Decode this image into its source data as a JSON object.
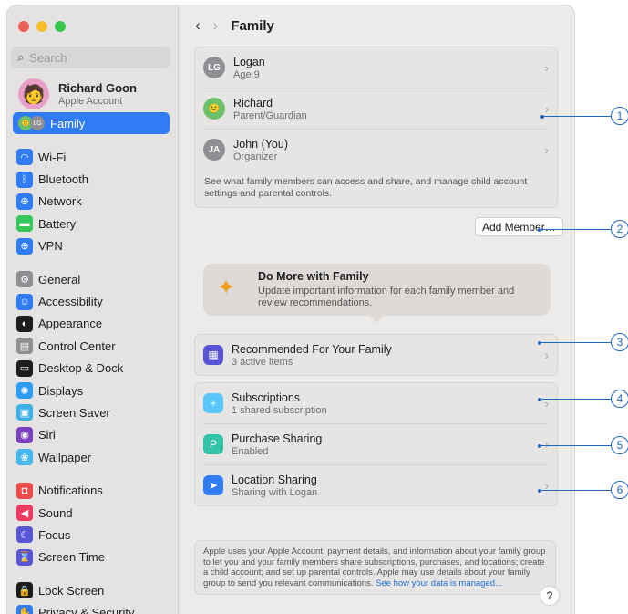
{
  "window": {
    "traffic_lights": {
      "close": "#ee5e58",
      "minimize": "#f5be2e",
      "zoom": "#37c64a"
    }
  },
  "sidebar": {
    "search": {
      "placeholder": "Search"
    },
    "account": {
      "name": "Richard Goon",
      "subtitle": "Apple Account"
    },
    "selected_item": {
      "label": "Family",
      "badge": "LG"
    },
    "groups": [
      [
        {
          "label": "Wi-Fi",
          "icon": "wifi-icon",
          "color": "#2f7cf6",
          "glyph": "◠"
        },
        {
          "label": "Bluetooth",
          "icon": "bluetooth-icon",
          "color": "#2f7cf6",
          "glyph": "ᛒ"
        },
        {
          "label": "Network",
          "icon": "network-icon",
          "color": "#2f7cf6",
          "glyph": "⊕"
        },
        {
          "label": "Battery",
          "icon": "battery-icon",
          "color": "#34c759",
          "glyph": "▬"
        },
        {
          "label": "VPN",
          "icon": "vpn-icon",
          "color": "#2f7cf6",
          "glyph": "⊕"
        }
      ],
      [
        {
          "label": "General",
          "icon": "gear-icon",
          "color": "#8e8e93",
          "glyph": "⚙"
        },
        {
          "label": "Accessibility",
          "icon": "accessibility-icon",
          "color": "#2f7cf6",
          "glyph": "☺"
        },
        {
          "label": "Appearance",
          "icon": "appearance-icon",
          "color": "#1d1d1f",
          "glyph": "◐"
        },
        {
          "label": "Control Center",
          "icon": "control-center-icon",
          "color": "#8e8e93",
          "glyph": "▤"
        },
        {
          "label": "Desktop & Dock",
          "icon": "desktop-dock-icon",
          "color": "#1d1d1f",
          "glyph": "▭"
        },
        {
          "label": "Displays",
          "icon": "displays-icon",
          "color": "#2f9cf6",
          "glyph": "✺"
        },
        {
          "label": "Screen Saver",
          "icon": "screen-saver-icon",
          "color": "#3db0e6",
          "glyph": "▣"
        },
        {
          "label": "Siri",
          "icon": "siri-icon",
          "color": "#7b3fbf",
          "glyph": "◉"
        },
        {
          "label": "Wallpaper",
          "icon": "wallpaper-icon",
          "color": "#45b8f0",
          "glyph": "❀"
        }
      ],
      [
        {
          "label": "Notifications",
          "icon": "notifications-icon",
          "color": "#ef4a4a",
          "glyph": "◘"
        },
        {
          "label": "Sound",
          "icon": "sound-icon",
          "color": "#ef3a60",
          "glyph": "◀"
        },
        {
          "label": "Focus",
          "icon": "focus-icon",
          "color": "#5856d6",
          "glyph": "☾"
        },
        {
          "label": "Screen Time",
          "icon": "screen-time-icon",
          "color": "#5856d6",
          "glyph": "⌛"
        }
      ],
      [
        {
          "label": "Lock Screen",
          "icon": "lock-icon",
          "color": "#1d1d1f",
          "glyph": "🔒"
        },
        {
          "label": "Privacy & Security",
          "icon": "privacy-hand-icon",
          "color": "#2f7cf6",
          "glyph": "✋"
        }
      ]
    ]
  },
  "header": {
    "title": "Family",
    "back": "‹",
    "forward": "›"
  },
  "members": [
    {
      "name": "Logan",
      "role": "Age 9",
      "initials": "LG",
      "color": "#8e8e93"
    },
    {
      "name": "Richard",
      "role": "Parent/Guardian",
      "initials": "",
      "color": "#6cc06a"
    },
    {
      "name": "John (You)",
      "role": "Organizer",
      "initials": "JA",
      "color": "#8e8e93"
    }
  ],
  "members_description": "See what family members can access and share, and manage child account settings and parental controls.",
  "add_member_label": "Add Member…",
  "banner": {
    "title": "Do More with Family",
    "body": "Update important information for each family member and review recommendations."
  },
  "recommended": {
    "title": "Recommended For Your Family",
    "subtitle": "3 active items"
  },
  "features": [
    {
      "title": "Subscriptions",
      "subtitle": "1 shared subscription",
      "color": "#5ac8fa",
      "glyph": "+"
    },
    {
      "title": "Purchase Sharing",
      "subtitle": "Enabled",
      "color": "#30c4a8",
      "glyph": "P"
    },
    {
      "title": "Location Sharing",
      "subtitle": "Sharing with Logan",
      "color": "#2f7cf6",
      "glyph": "➤"
    }
  ],
  "footnote": {
    "text": "Apple uses your Apple Account, payment details, and information about your family group to let you and your family members share subscriptions, purchases, and locations; create a child account; and set up parental controls. Apple may use details about your family group to send you relevant communications.",
    "link": "See how your data is managed..."
  },
  "help_label": "?",
  "callouts": [
    "1",
    "2",
    "3",
    "4",
    "5",
    "6"
  ],
  "accent_color": "#2266c4"
}
